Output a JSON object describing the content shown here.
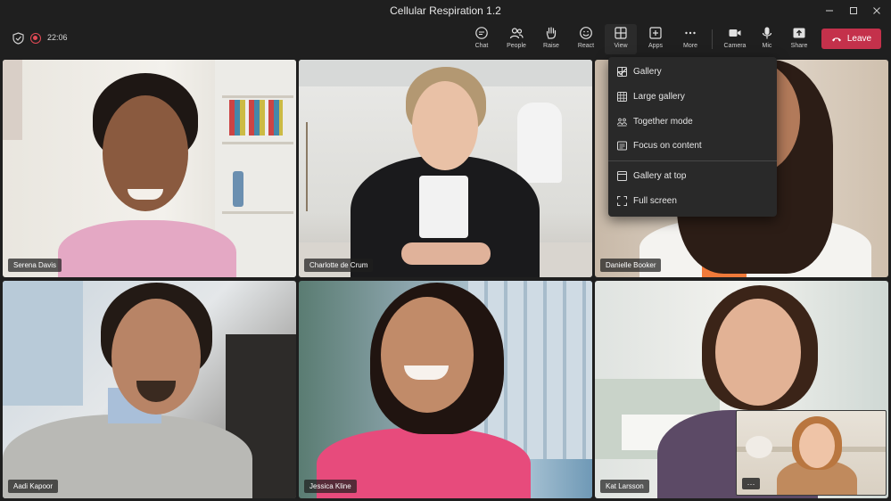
{
  "window": {
    "title": "Cellular Respiration 1.2"
  },
  "meeting": {
    "timer": "22:06"
  },
  "toolbar": {
    "buttons": [
      {
        "label": "Chat",
        "icon": "chat-icon"
      },
      {
        "label": "People",
        "icon": "people-icon"
      },
      {
        "label": "Raise",
        "icon": "raise-hand-icon"
      },
      {
        "label": "React",
        "icon": "react-icon"
      },
      {
        "label": "View",
        "icon": "view-grid-icon"
      },
      {
        "label": "Apps",
        "icon": "apps-icon"
      },
      {
        "label": "More",
        "icon": "more-icon"
      },
      {
        "label": "Camera",
        "icon": "camera-icon"
      },
      {
        "label": "Mic",
        "icon": "mic-icon"
      },
      {
        "label": "Share",
        "icon": "share-icon"
      }
    ],
    "leave_label": "Leave"
  },
  "view_menu": {
    "items": [
      {
        "label": "Gallery",
        "icon": "gallery-icon",
        "selected": true
      },
      {
        "label": "Large gallery",
        "icon": "large-gallery-icon"
      },
      {
        "label": "Together mode",
        "icon": "together-mode-icon"
      },
      {
        "label": "Focus on content",
        "icon": "focus-content-icon"
      },
      {
        "label": "Gallery at top",
        "icon": "gallery-top-icon"
      },
      {
        "label": "Full screen",
        "icon": "full-screen-icon"
      }
    ]
  },
  "participants": [
    {
      "name": "Serena Davis"
    },
    {
      "name": "Charlotte de Crum"
    },
    {
      "name": "Danielle Booker"
    },
    {
      "name": "Aadi Kapoor"
    },
    {
      "name": "Jessica Kline"
    },
    {
      "name": "Kat Larsson"
    }
  ],
  "self_view": {
    "more_label": "···"
  },
  "colors": {
    "leave": "#c4314b",
    "background": "#1f1f1f",
    "menu": "#292929"
  }
}
